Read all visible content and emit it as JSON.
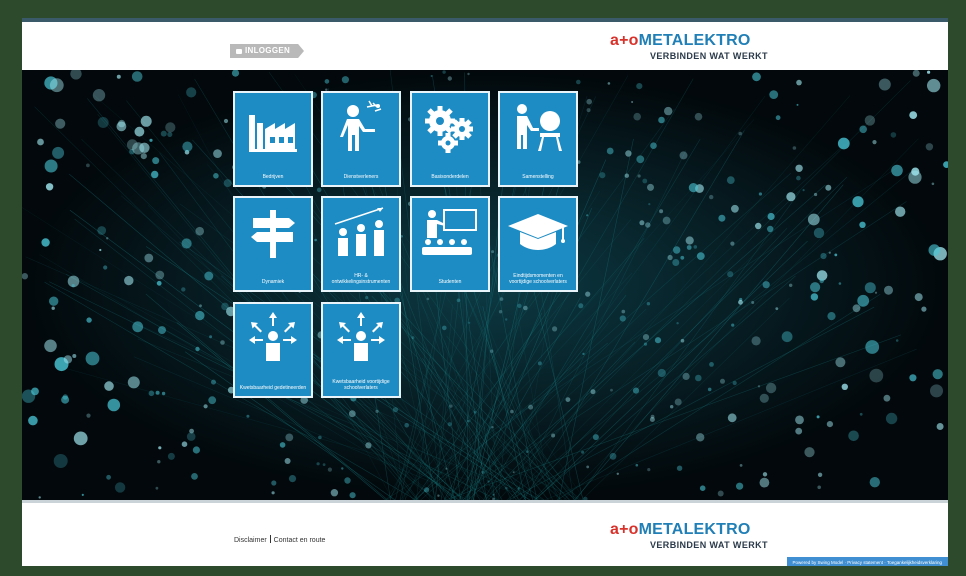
{
  "header": {
    "login_label": "INLOGGEN",
    "logo_brand_prefix": "a+o",
    "logo_brand_name": "METALEKTRO",
    "logo_tagline": "VERBINDEN WAT WERKT"
  },
  "tiles": [
    {
      "label": "Bedrijven",
      "icon": "factory-icon"
    },
    {
      "label": "Dienstverleners",
      "icon": "welder-icon"
    },
    {
      "label": "Basisonderdelen",
      "icon": "gears-icon"
    },
    {
      "label": "Samenstelling",
      "icon": "worker-machine-icon"
    },
    {
      "label": "Dynamiek",
      "icon": "signpost-icon"
    },
    {
      "label": "HR- & ontwikkelingsinstrumenten",
      "icon": "growth-people-icon"
    },
    {
      "label": "Studenten",
      "icon": "classroom-icon"
    },
    {
      "label": "Eindtijdsmomenten en voortijdige schoolverlaters",
      "icon": "graduation-cap-icon"
    },
    {
      "label": "Kwetsbaarheid gedetineerden",
      "icon": "person-arrows-icon"
    },
    {
      "label": "Kwetsbaarheid voortijdige schoolverlaters",
      "icon": "person-arrows-icon"
    }
  ],
  "footer": {
    "disclaimer_label": "Disclaimer",
    "contact_label": "Contact en route",
    "logo_brand_prefix": "a+o",
    "logo_brand_name": "METALEKTRO",
    "logo_tagline": "VERBINDEN WAT WERKT",
    "powered_text": "Powered by Swing Model · Privacy statement · Toegankelijkheidsverklaring"
  },
  "colors": {
    "tile_blue": "#1e8cc4",
    "brand_red": "#d9322b",
    "brand_blue": "#1f7fb6",
    "frame_green": "#2e4a2c"
  }
}
